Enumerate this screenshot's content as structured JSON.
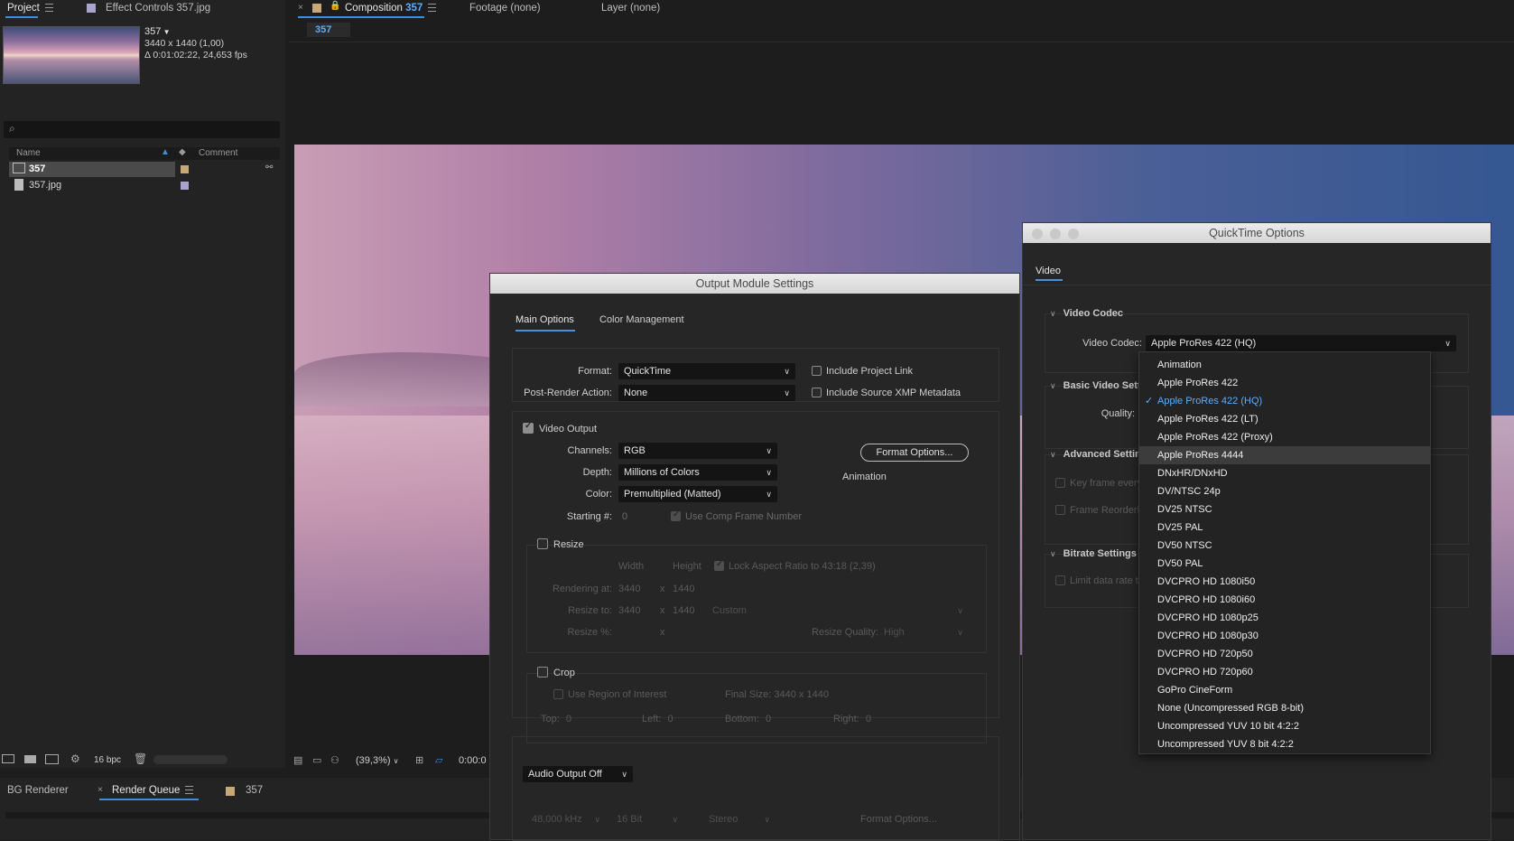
{
  "project_panel": {
    "tab_label": "Project",
    "effect_controls_label": "Effect Controls 357.jpg",
    "thumb_name": "357",
    "thumb_dims": "3440 x 1440 (1,00)",
    "thumb_duration": "Δ 0:01:02:22, 24,653 fps",
    "col_name": "Name",
    "col_comment": "Comment",
    "items": [
      {
        "name": "357",
        "swatch_color": "#c8a878"
      },
      {
        "name": "357.jpg",
        "swatch_color": "#a9a4cc"
      }
    ],
    "bpc": "16 bpc"
  },
  "comp_panel": {
    "tab_label": "Composition",
    "comp_name": "357",
    "footage_tab": "Footage (none)",
    "layer_tab": "Layer (none)",
    "sub_tab": "357",
    "zoom": "(39,3%)",
    "timecode": "0:00:0"
  },
  "bottom_panel": {
    "bg_renderer": "BG Renderer",
    "render_queue": "Render Queue",
    "comp_tab": "357"
  },
  "output_module": {
    "title": "Output Module Settings",
    "tabs": [
      "Main Options",
      "Color Management"
    ],
    "format_label": "Format:",
    "format_value": "QuickTime",
    "post_render_label": "Post-Render Action:",
    "post_render_value": "None",
    "include_project_link": "Include Project Link",
    "include_xmp": "Include Source XMP Metadata",
    "video_output": "Video Output",
    "channels_label": "Channels:",
    "channels_value": "RGB",
    "depth_label": "Depth:",
    "depth_value": "Millions of Colors",
    "color_label": "Color:",
    "color_value": "Premultiplied (Matted)",
    "starting_label": "Starting #:",
    "starting_value": "0",
    "use_comp_frame": "Use Comp Frame Number",
    "format_options": "Format Options...",
    "codec_summary": "Animation",
    "resize": "Resize",
    "width_label": "Width",
    "height_label": "Height",
    "lock_aspect": "Lock Aspect Ratio to 43:18 (2,39)",
    "rendering_at_label": "Rendering at:",
    "rendering_w": "3440",
    "rendering_x": "x",
    "rendering_h": "1440",
    "resize_to_label": "Resize to:",
    "resize_w": "3440",
    "resize_x": "x",
    "resize_h": "1440",
    "resize_preset": "Custom",
    "resize_pct_label": "Resize %:",
    "resize_pct_x": "x",
    "resize_quality_label": "Resize Quality:",
    "resize_quality_value": "High",
    "crop": "Crop",
    "use_roi": "Use Region of Interest",
    "final_size": "Final Size: 3440 x 1440",
    "top_label": "Top:",
    "top_value": "0",
    "left_label": "Left:",
    "left_value": "0",
    "bottom_label": "Bottom:",
    "bottom_value": "0",
    "right_label": "Right:",
    "right_value": "0",
    "audio_output": "Audio Output Off",
    "audio_rate": "48,000 kHz",
    "audio_bits": "16 Bit",
    "audio_channels": "Stereo",
    "audio_format_options": "Format Options..."
  },
  "quicktime": {
    "title": "QuickTime Options",
    "tab_video": "Video",
    "sec_video_codec": "Video Codec",
    "video_codec_label": "Video Codec:",
    "video_codec_value": "Apple ProRes 422 (HQ)",
    "sec_basic": "Basic Video Setti",
    "quality_label": "Quality:",
    "sec_advanced": "Advanced Setting",
    "keyframe": "Key frame every",
    "frame_reordering": "Frame Reorderin",
    "sec_bitrate": "Bitrate Settings",
    "limit_rate": "Limit data rate to",
    "codec_options": [
      "Animation",
      "Apple ProRes 422",
      "Apple ProRes 422 (HQ)",
      "Apple ProRes 422 (LT)",
      "Apple ProRes 422 (Proxy)",
      "Apple ProRes 4444",
      "DNxHR/DNxHD",
      "DV/NTSC 24p",
      "DV25 NTSC",
      "DV25 PAL",
      "DV50 NTSC",
      "DV50 PAL",
      "DVCPRO HD 1080i50",
      "DVCPRO HD 1080i60",
      "DVCPRO HD 1080p25",
      "DVCPRO HD 1080p30",
      "DVCPRO HD 720p50",
      "DVCPRO HD 720p60",
      "GoPro CineForm",
      "None (Uncompressed RGB 8-bit)",
      "Uncompressed YUV 10 bit 4:2:2",
      "Uncompressed YUV 8 bit 4:2:2"
    ],
    "selected_index": 2,
    "hover_index": 5,
    "accent_color": "#5aaeff"
  }
}
